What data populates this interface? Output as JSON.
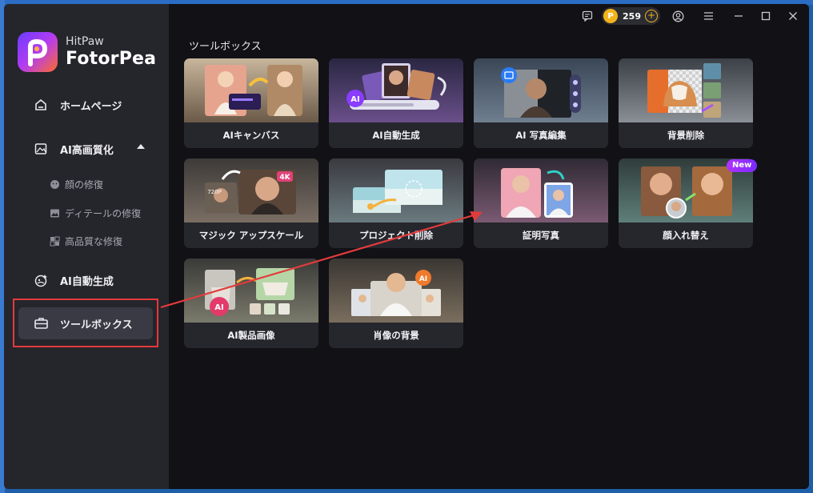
{
  "app": {
    "brand_small": "HitPaw",
    "brand_big": "FotorPea"
  },
  "topbar": {
    "coin_count": "259",
    "coin_plus": "+"
  },
  "sidebar": {
    "home": "ホームページ",
    "ai_enhance": "AI高画質化",
    "sub_face": "顔の修復",
    "sub_detail": "ディテールの修復",
    "sub_quality": "高品質な修復",
    "ai_generate": "AI自動生成",
    "toolbox": "ツールボックス"
  },
  "main": {
    "section_title": "ツールボックス",
    "badge_new": "New",
    "cards": [
      {
        "label": "AIキャンバス"
      },
      {
        "label": "AI自動生成"
      },
      {
        "label": "AI 写真編集"
      },
      {
        "label": "背景削除"
      },
      {
        "label": "マジック アップスケール"
      },
      {
        "label": "プロジェクト削除"
      },
      {
        "label": "証明写真"
      },
      {
        "label": "顔入れ替え"
      },
      {
        "label": "AI製品画像"
      },
      {
        "label": "肖像の背景"
      }
    ]
  },
  "thumb_text": {
    "ai": "AI",
    "res_720p": "720P",
    "res_4k": "4K"
  },
  "colors": {
    "accent_purple": "#8a3cff",
    "highlight_red": "#e23b3b",
    "coin_gold": "#f2b41c"
  }
}
